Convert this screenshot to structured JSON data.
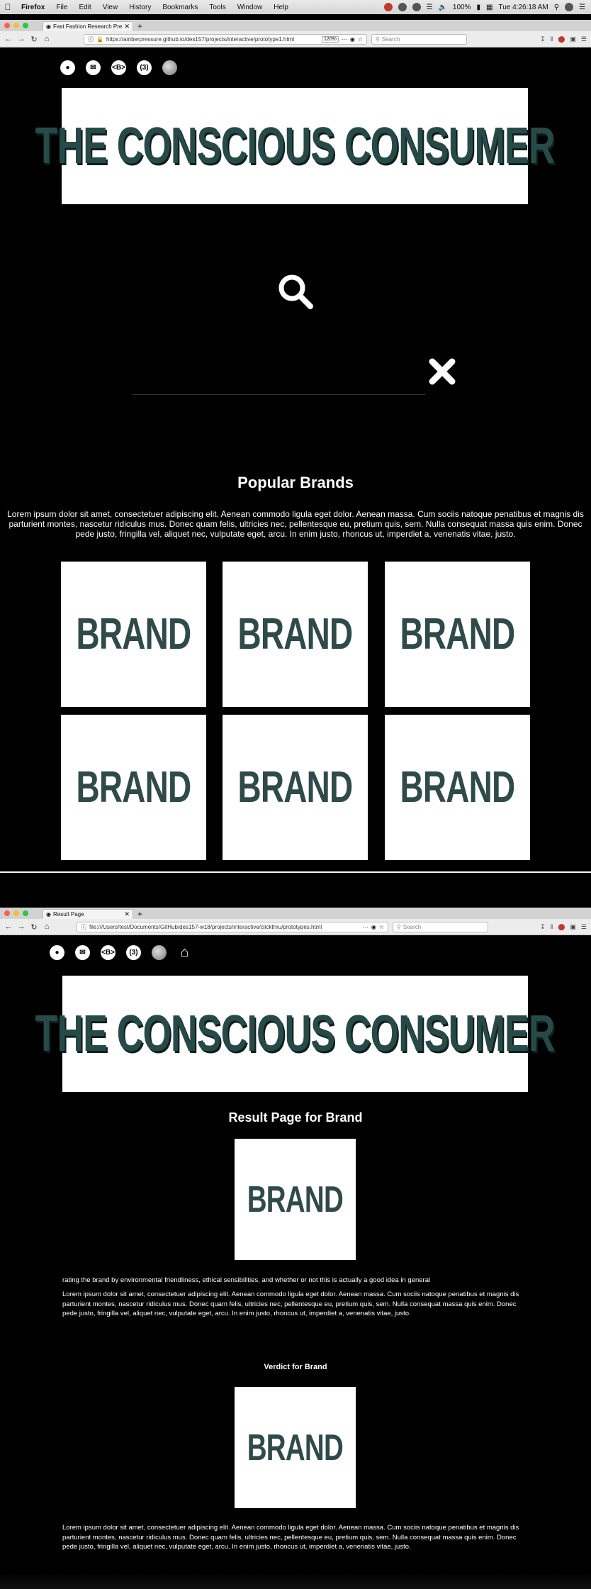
{
  "menubar": {
    "app": "Firefox",
    "items": [
      "File",
      "Edit",
      "View",
      "History",
      "Bookmarks",
      "Tools",
      "Window",
      "Help"
    ],
    "battery": "100%",
    "clock": "Tue 4:26:18 AM"
  },
  "browser1": {
    "tab_title": "Fast Fashion Research Presen",
    "url": "https://amberpressure.github.io/des157/projects/interactive/prototype1.html",
    "zoom": "120%",
    "search_placeholder": "Search"
  },
  "browser2": {
    "tab_title": "Result Page",
    "url": "file:///Users/test/Documents/GitHub/des157-w18/projects/interactive/clickthru/prototypes.html",
    "search_placeholder": "Search"
  },
  "socials": {
    "github": "●",
    "mail": "✉",
    "code": "<B>",
    "cc": "(3)",
    "home": "⌂"
  },
  "banner_title": "THE CONSCIOUS CONSUMER",
  "page1": {
    "popular_heading": "Popular Brands",
    "intro": "Lorem ipsum dolor sit amet, consectetuer adipiscing elit. Aenean commodo ligula eget dolor. Aenean massa. Cum sociis natoque penatibus et magnis dis parturient montes, nascetur ridiculus mus. Donec quam felis, ultricies nec, pellentesque eu, pretium quis, sem. Nulla consequat massa quis enim. Donec pede justo, fringilla vel, aliquet nec, vulputate eget, arcu. In enim justo, rhoncus ut, imperdiet a, venenatis vitae, justo.",
    "brands": [
      "BRAND",
      "BRAND",
      "BRAND",
      "BRAND",
      "BRAND",
      "BRAND"
    ]
  },
  "page2": {
    "result_heading": "Result Page for Brand",
    "brand_label": "BRAND",
    "rating_note": "rating the brand by environmental friendliness, ethical sensibilities, and whether or not this is actually a good idea in general",
    "para1": "Lorem ipsum dolor sit amet, consectetuer adipiscing elit. Aenean commodo ligula eget dolor. Aenean massa. Cum sociis natoque penatibus et magnis dis parturient montes, nascetur ridiculus mus. Donec quam felis, ultricies nec, pellentesque eu, pretium quis, sem. Nulla consequat massa quis enim. Donec pede justo, fringilla vel, aliquet nec, vulputate eget, arcu. In enim justo, rhoncus ut, imperdiet a, venenatis vitae, justo.",
    "verdict_heading": "Verdict for Brand",
    "verdict_brand_label": "BRAND",
    "para2": "Lorem ipsum dolor sit amet, consectetuer adipiscing elit. Aenean commodo ligula eget dolor. Aenean massa. Cum sociis natoque penatibus et magnis dis parturient montes, nascetur ridiculus mus. Donec quam felis, ultricies nec, pellentesque eu, pretium quis, sem. Nulla consequat massa quis enim. Donec pede justo, fringilla vel, aliquet nec, vulputate eget, arcu. In enim justo, rhoncus ut, imperdiet a, venenatis vitae, justo."
  }
}
